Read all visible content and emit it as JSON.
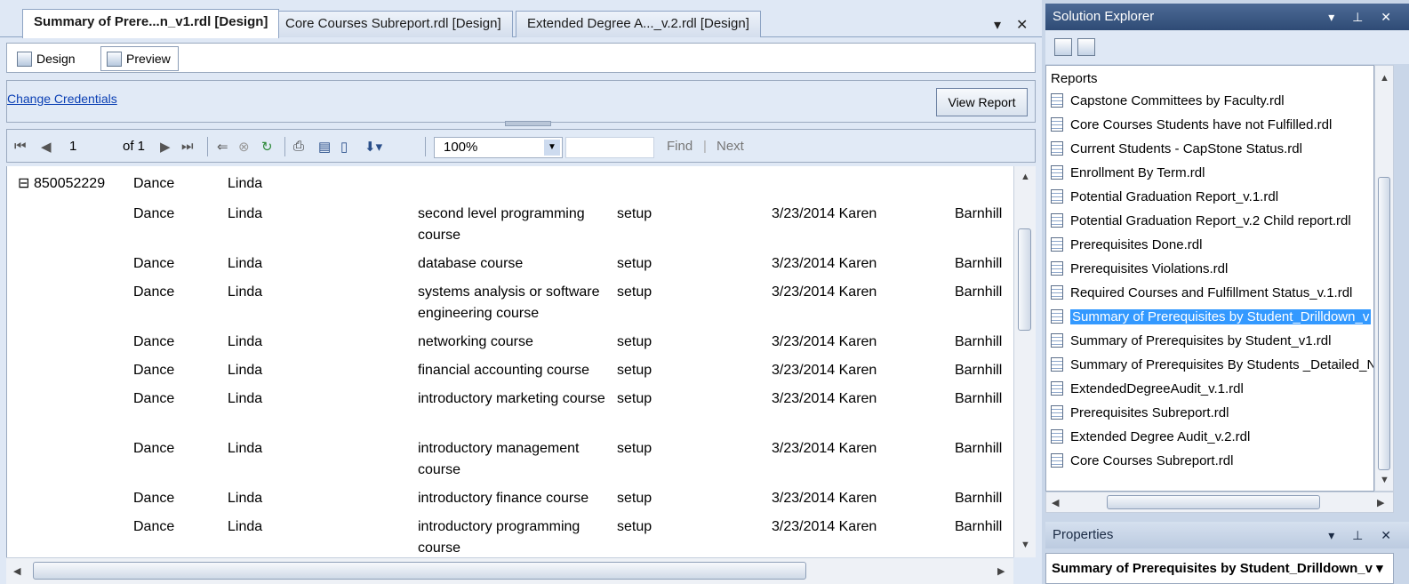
{
  "document": {
    "tabs": [
      "Summary of Prere...n_v1.rdl [Design]",
      "Core Courses Subreport.rdl [Design]",
      "Extended Degree A..._v.2.rdl [Design]"
    ],
    "tab_overflow_glyph": "▾",
    "close_glyph": "✕",
    "design_tabs": [
      "Design",
      "Preview"
    ],
    "change_credentials": "Change Credentials",
    "view_report": "View Report",
    "toolbar": {
      "page_current": "1",
      "page_of": "of 1",
      "zoom": "100%",
      "find": "Find",
      "separator": "|",
      "next": "Next"
    }
  },
  "report": {
    "group": {
      "toggle": "⊟",
      "id": "850052229",
      "last": "Dance",
      "first": "Linda"
    },
    "rows": [
      {
        "last": "Dance",
        "first": "Linda",
        "course": "second level programming course",
        "status": "setup",
        "date_by": "3/23/2014 Karen",
        "by_last": "Barnhill"
      },
      {
        "last": "Dance",
        "first": "Linda",
        "course": "database course",
        "status": "setup",
        "date_by": "3/23/2014 Karen",
        "by_last": "Barnhill"
      },
      {
        "last": "Dance",
        "first": "Linda",
        "course": "systems analysis or software engineering course",
        "status": "setup",
        "date_by": "3/23/2014 Karen",
        "by_last": "Barnhill"
      },
      {
        "last": "Dance",
        "first": "Linda",
        "course": "networking course",
        "status": "setup",
        "date_by": "3/23/2014 Karen",
        "by_last": "Barnhill"
      },
      {
        "last": "Dance",
        "first": "Linda",
        "course": "financial accounting course",
        "status": "setup",
        "date_by": "3/23/2014 Karen",
        "by_last": "Barnhill"
      },
      {
        "last": "Dance",
        "first": "Linda",
        "course": "introductory marketing course",
        "status": "setup",
        "date_by": "3/23/2014 Karen",
        "by_last": "Barnhill"
      },
      {
        "last": "Dance",
        "first": "Linda",
        "course": "introductory management course",
        "status": "setup",
        "date_by": "3/23/2014 Karen",
        "by_last": "Barnhill"
      },
      {
        "last": "Dance",
        "first": "Linda",
        "course": "introductory finance course",
        "status": "setup",
        "date_by": "3/23/2014 Karen",
        "by_last": "Barnhill"
      },
      {
        "last": "Dance",
        "first": "Linda",
        "course": "introductory programming course",
        "status": "setup",
        "date_by": "3/23/2014 Karen",
        "by_last": "Barnhill"
      }
    ]
  },
  "solution_explorer": {
    "title": "Solution Explorer",
    "header_buttons": "▾ ⊥ ✕",
    "root": "Reports",
    "items": [
      "Capstone Committees by Faculty.rdl",
      "Core Courses Students have not Fulfilled.rdl",
      "Current Students - CapStone Status.rdl",
      "Enrollment By Term.rdl",
      "Potential Graduation Report_v.1.rdl",
      "Potential Graduation Report_v.2 Child report.rdl",
      "Prerequisites Done.rdl",
      "Prerequisites Violations.rdl",
      "Required Courses and Fulfillment Status_v.1.rdl",
      "Summary of Prerequisites by Student_Drilldown_v",
      "Summary of Prerequisites by Student_v1.rdl",
      "Summary of Prerequisites By Students _Detailed_N",
      "ExtendedDegreeAudit_v.1.rdl",
      "Prerequisites Subreport.rdl",
      "Extended Degree Audit_v.2.rdl",
      "Core Courses Subreport.rdl"
    ],
    "selected_index": 9
  },
  "properties": {
    "title": "Properties",
    "header_buttons": "▾ ⊥ ✕",
    "object": "Summary of Prerequisites by Student_Drilldown_v ▾"
  }
}
